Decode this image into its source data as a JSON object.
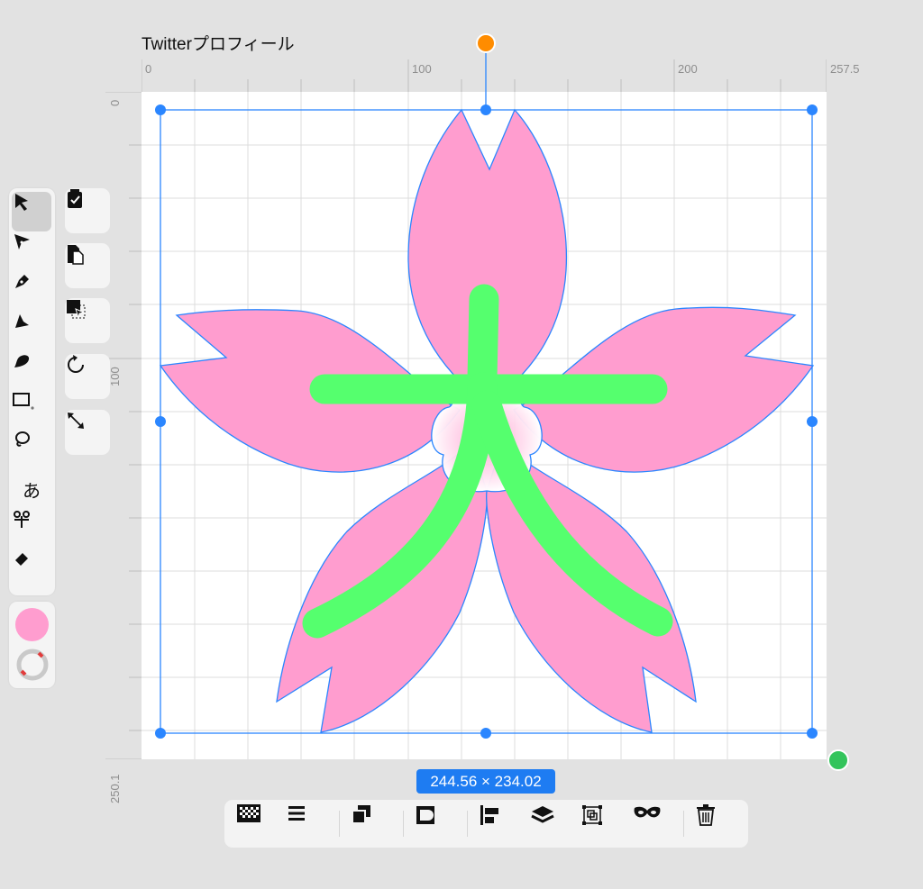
{
  "document": {
    "title": "Twitterプロフィール"
  },
  "rulers": {
    "top_labels": [
      "0",
      "100",
      "200",
      "257.5"
    ],
    "left_labels": [
      "0",
      "100",
      "250.1"
    ]
  },
  "selection": {
    "size_label": "244.56 × 234.02"
  },
  "tools": [
    {
      "name": "select-tool-icon",
      "selected": true
    },
    {
      "name": "direct-select-tool-icon",
      "selected": false
    },
    {
      "name": "pen-tool-icon",
      "selected": false
    },
    {
      "name": "node-tool-icon",
      "selected": false
    },
    {
      "name": "brush-tool-icon",
      "selected": false
    },
    {
      "name": "rectangle-tool-icon",
      "selected": false
    },
    {
      "name": "lasso-tool-icon",
      "selected": false
    },
    {
      "name": "text-tool-icon",
      "selected": false
    },
    {
      "name": "scissors-tool-icon",
      "selected": false
    },
    {
      "name": "eraser-tool-icon",
      "selected": false
    }
  ],
  "text_tool_glyph": "あ",
  "colors": {
    "fill": "#ff9dcf",
    "stroke_gradient": "gradient",
    "accent": "#1e7cf2",
    "petal": "#ff9dcf",
    "stroke_green": "#55ff6e",
    "handle_orange": "#ff8c00",
    "handle_green": "#33c45b"
  },
  "actions": [
    "clipboard-check-icon",
    "paste-icon",
    "select-inside-icon",
    "rotate-icon",
    "resize-icon"
  ],
  "bottom_bar": [
    "transparency-grid-icon",
    "align-menu-icon",
    "arrange-icon",
    "boolean-icon",
    "align-left-icon",
    "layers-icon",
    "group-icon",
    "mask-icon",
    "trash-icon"
  ]
}
